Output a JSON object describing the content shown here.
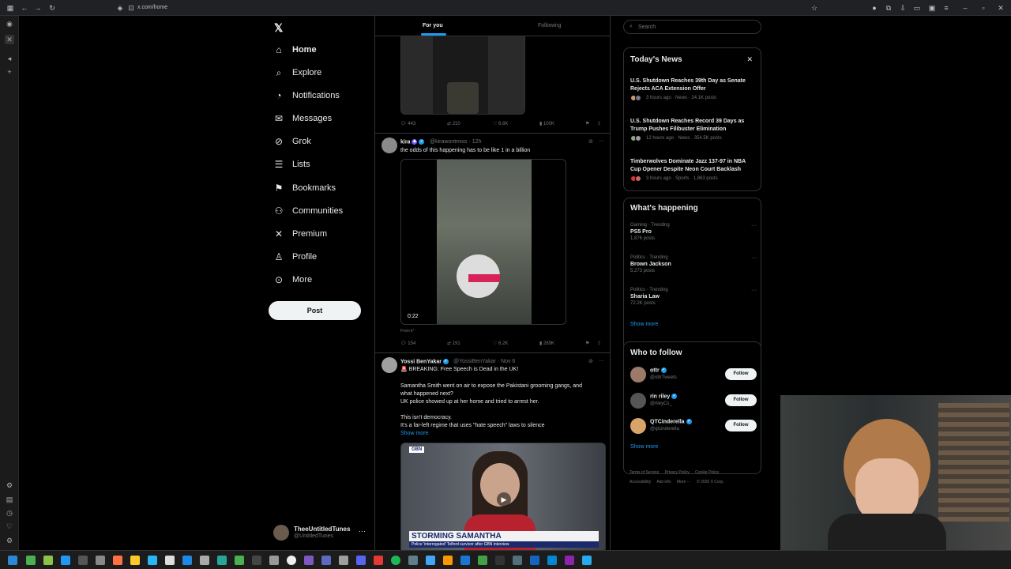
{
  "browser": {
    "url": "x.com/home"
  },
  "nav": {
    "items": [
      {
        "label": "Home",
        "icon": "home-icon"
      },
      {
        "label": "Explore",
        "icon": "search-icon"
      },
      {
        "label": "Notifications",
        "icon": "bell-icon"
      },
      {
        "label": "Messages",
        "icon": "mail-icon"
      },
      {
        "label": "Grok",
        "icon": "grok-icon"
      },
      {
        "label": "Lists",
        "icon": "list-icon"
      },
      {
        "label": "Bookmarks",
        "icon": "bookmark-icon"
      },
      {
        "label": "Communities",
        "icon": "people-icon"
      },
      {
        "label": "Premium",
        "icon": "x-icon"
      },
      {
        "label": "Profile",
        "icon": "person-icon"
      },
      {
        "label": "More",
        "icon": "more-circle-icon"
      }
    ],
    "post_label": "Post",
    "account": {
      "name": "TheeUntitledTunes",
      "handle": "@UntitledTunes"
    }
  },
  "feed": {
    "tabs": [
      "For you",
      "Following"
    ],
    "post0": {
      "replies": "443",
      "reposts": "210",
      "likes": "6.8K",
      "views": "100K"
    },
    "post1": {
      "name": "kira",
      "handle": "@kirawontmiss · 12h",
      "text": "the odds of this happening has to be like 1 in a billion",
      "duration": "0:22",
      "from": "From k°",
      "replies": "154",
      "reposts": "191",
      "likes": "6.2K",
      "views": "289K"
    },
    "post2": {
      "name": "Yossi BenYakar",
      "handle": "@YossiBenYakar · Nov 6",
      "line1": "🚨 BREAKING: Free Speech is Dead in the UK!",
      "line2": "Samantha Smith went on air to expose the Pakistani grooming gangs, and",
      "line3": "what happened next?",
      "line4": "UK police showed up at her home and tried to arrest her.",
      "line5": "This isn't democracy.",
      "line6": "It's a far-left regime that uses \"hate speech\" laws to silence",
      "show_more": "Show more",
      "video_banner": "STORMING SAMANTHA",
      "video_sub": "Police 'interrogated' Telford survivor after GBN interview",
      "video_logo": "GBN"
    }
  },
  "sidebar": {
    "search_placeholder": "Search",
    "news": {
      "title": "Today's News",
      "items": [
        {
          "title": "U.S. Shutdown Reaches 39th Day as Senate Rejects ACA Extension Offer",
          "meta": "3 hours ago · News · 24.1K posts"
        },
        {
          "title": "U.S. Shutdown Reaches Record 39 Days as Trump Pushes Filibuster Elimination",
          "meta": "12 hours ago · News · 354.5K posts"
        },
        {
          "title": "Timberwolves Dominate Jazz 137-97 in NBA Cup Opener Despite Neon Court Backlash",
          "meta": "3 hours ago · Sports · 1,863 posts"
        }
      ]
    },
    "happening": {
      "title": "What's happening",
      "items": [
        {
          "category": "Gaming · Trending",
          "name": "PS5 Pro",
          "posts": "1,876 posts"
        },
        {
          "category": "Politics · Trending",
          "name": "Brown Jackson",
          "posts": "5,273 posts"
        },
        {
          "category": "Politics · Trending",
          "name": "Sharia Law",
          "posts": "72.2K posts"
        }
      ],
      "show_more": "Show more"
    },
    "who_to_follow": {
      "title": "Who to follow",
      "items": [
        {
          "name": "ottr",
          "handle": "@ottrTweets",
          "button": "Follow"
        },
        {
          "name": "rin riley",
          "handle": "@rileyCs_",
          "button": "Follow"
        },
        {
          "name": "QTCinderella",
          "handle": "@qtcinderella",
          "button": "Follow"
        }
      ],
      "show_more": "Show more"
    },
    "footer": {
      "links": [
        "Terms of Service",
        "Privacy Policy",
        "Cookie Policy",
        "Accessibility",
        "Ads info",
        "More ···",
        "© 2025 X Corp."
      ]
    }
  },
  "colors": {
    "accent": "#1d9bf0",
    "background": "#000000",
    "text": "#e7e9ea",
    "muted": "#71767b"
  }
}
